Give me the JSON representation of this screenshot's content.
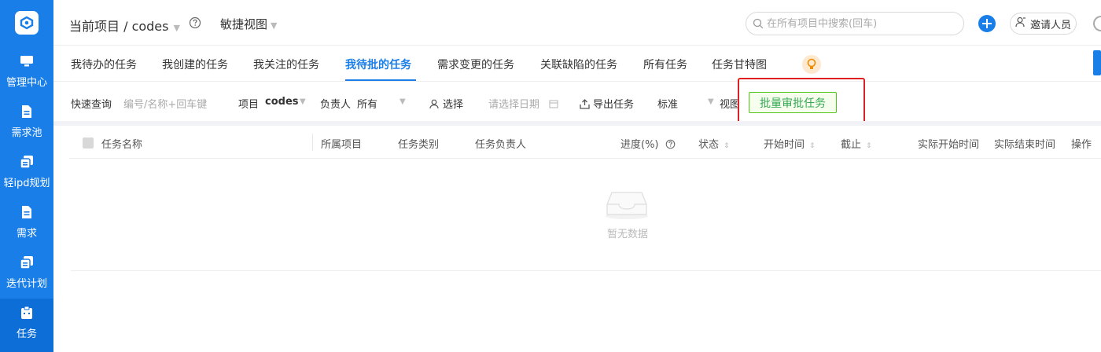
{
  "sidebar": {
    "logo": "app-logo",
    "items": [
      {
        "label": "管理中心",
        "icon": "monitor-icon"
      },
      {
        "label": "需求池",
        "icon": "document-icon"
      },
      {
        "label": "轻ipd规划",
        "icon": "copy-icon"
      },
      {
        "label": "需求",
        "icon": "document-icon"
      },
      {
        "label": "迭代计划",
        "icon": "copy-icon"
      },
      {
        "label": "任务",
        "icon": "clipboard-icon",
        "active": true
      }
    ]
  },
  "header": {
    "project_label": "当前项目 / codes",
    "view_label": "敏捷视图",
    "search_placeholder": "在所有项目中搜索(回车)",
    "invite_label": "邀请人员"
  },
  "tabs": [
    {
      "label": "我待办的任务"
    },
    {
      "label": "我创建的任务"
    },
    {
      "label": "我关注的任务"
    },
    {
      "label": "我待批的任务",
      "active": true
    },
    {
      "label": "需求变更的任务"
    },
    {
      "label": "关联缺陷的任务"
    },
    {
      "label": "所有任务"
    },
    {
      "label": "任务甘特图"
    }
  ],
  "filters": {
    "quick_query_label": "快速查询",
    "quick_query_placeholder": "编号/名称+回车键",
    "project_label": "项目",
    "project_value": "codes",
    "assignee_label": "负责人",
    "assignee_value": "所有",
    "select_label": "选择",
    "date_placeholder": "请选择日期",
    "export_label": "导出任务",
    "standard_label": "标准",
    "view_label": "视图",
    "batch_approve_label": "批量审批任务"
  },
  "table": {
    "columns": [
      "任务名称",
      "所属项目",
      "任务类别",
      "任务负责人",
      "进度(%)",
      "状态",
      "开始时间",
      "截止",
      "实际开始时间",
      "实际结束时间",
      "操作"
    ],
    "empty_text": "暂无数据"
  },
  "colors": {
    "primary": "#1a7ee8",
    "sidebar": "#1a7ee8",
    "batch_button_border": "#52c41a",
    "highlight": "#e02020"
  }
}
